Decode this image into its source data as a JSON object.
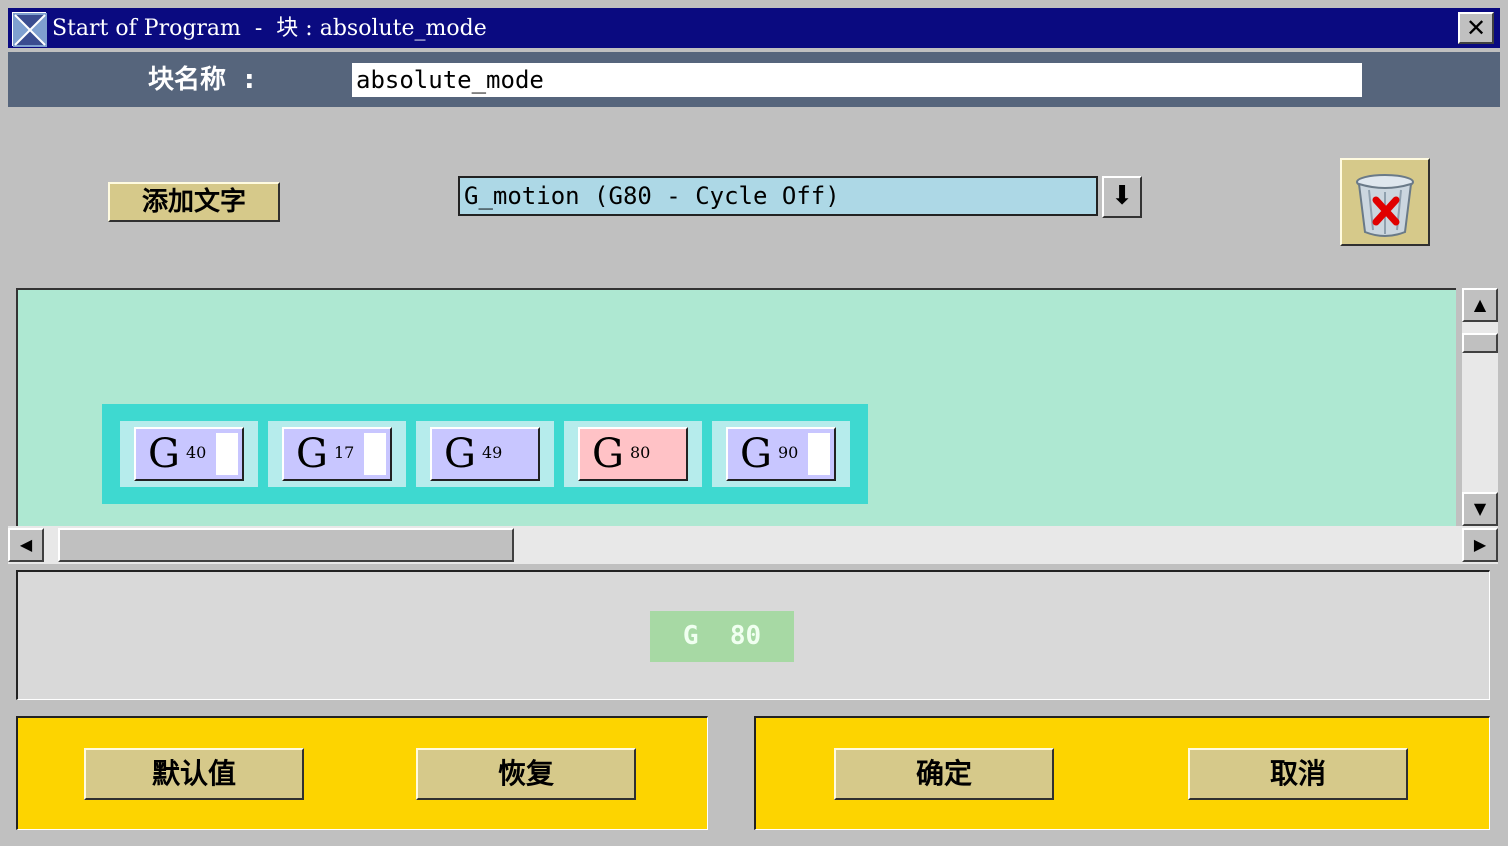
{
  "window": {
    "title": "Start of Program  -  块 : absolute_mode",
    "close_label": "✕"
  },
  "block_name": {
    "label": "块名称  :",
    "value": "absolute_mode"
  },
  "toolbar": {
    "add_text_label": "添加文字",
    "word_select_value": "G_motion (G80 - Cycle Off)",
    "dropdown_glyph": "⬇",
    "trash_icon": "recycle-bin-delete-icon"
  },
  "words": [
    {
      "letter": "G",
      "number": "40",
      "selected": false
    },
    {
      "letter": "G",
      "number": "17",
      "selected": false
    },
    {
      "letter": "G",
      "number": "49",
      "selected": false
    },
    {
      "letter": "G",
      "number": "80",
      "selected": true
    },
    {
      "letter": "G",
      "number": "90",
      "selected": false
    }
  ],
  "scrollbars": {
    "up": "▲",
    "down": "▼",
    "left": "◀",
    "right": "▶"
  },
  "preview": {
    "text": "G  80"
  },
  "buttons": {
    "default": "默认值",
    "restore": "恢复",
    "ok": "确定",
    "cancel": "取消"
  },
  "colors": {
    "title_bar": "#0a0a80",
    "canvas": "#aee8d2",
    "block_container": "#3ed9d0",
    "word_button": "#c8c6ff",
    "selected_word_button": "#ffc2c6",
    "panel": "#fdd400",
    "button": "#d6c98a"
  }
}
